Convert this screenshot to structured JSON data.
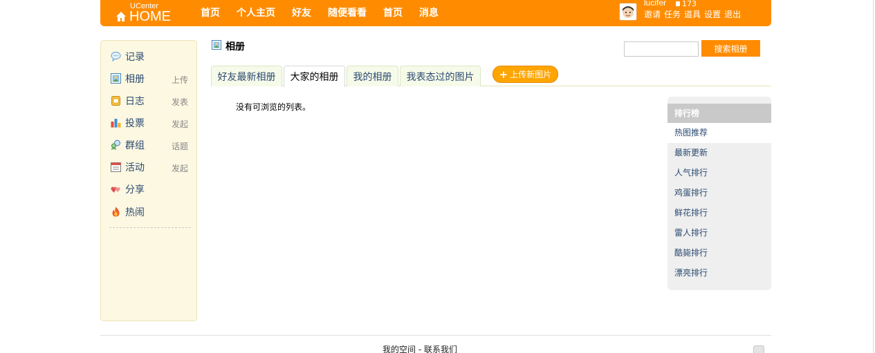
{
  "header": {
    "logo": {
      "line1": "UCenter",
      "line2": "HOME"
    },
    "nav": [
      "首页",
      "个人主页",
      "好友",
      "随便看看",
      "首页",
      "消息"
    ],
    "user": {
      "name": "lucifer",
      "credit": "173",
      "links": [
        "邀请",
        "任务",
        "道具",
        "设置",
        "退出"
      ]
    }
  },
  "sidebar": {
    "items": [
      {
        "label": "记录",
        "action": "",
        "icon": "speech-bubble-icon"
      },
      {
        "label": "相册",
        "action": "上传",
        "icon": "album-icon"
      },
      {
        "label": "日志",
        "action": "发表",
        "icon": "notebook-icon"
      },
      {
        "label": "投票",
        "action": "发起",
        "icon": "bar-chart-icon"
      },
      {
        "label": "群组",
        "action": "话题",
        "icon": "group-icon"
      },
      {
        "label": "活动",
        "action": "发起",
        "icon": "calendar-icon"
      },
      {
        "label": "分享",
        "action": "",
        "icon": "hearts-icon"
      },
      {
        "label": "热闹",
        "action": "",
        "icon": "fire-icon"
      }
    ]
  },
  "main": {
    "title": "相册",
    "search": {
      "value": "",
      "button_label": "搜索相册"
    },
    "tabs": [
      {
        "label": "好友最新相册",
        "active": false
      },
      {
        "label": "大家的相册",
        "active": true
      },
      {
        "label": "我的相册",
        "active": false
      },
      {
        "label": "我表态过的图片",
        "active": false
      }
    ],
    "upload_label": "上传新图片",
    "empty_message": "没有可浏览的列表。"
  },
  "ranking": {
    "title": "排行榜",
    "items": [
      "热图推荐",
      "最新更新",
      "人气排行",
      "鸡蛋排行",
      "鲜花排行",
      "雷人排行",
      "酷毙排行",
      "漂亮排行"
    ],
    "active_index": 0
  },
  "footer": {
    "links": [
      "我的空间",
      "联系我们"
    ],
    "separator": " - "
  },
  "colors": {
    "accent": "#ff8c00",
    "sidebar_bg": "#fcf8e2",
    "link": "#2b4a70"
  }
}
